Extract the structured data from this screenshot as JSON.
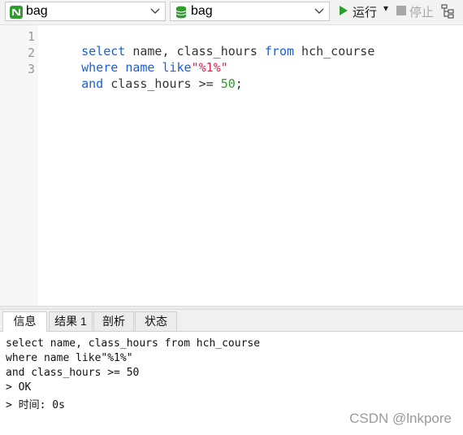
{
  "toolbar": {
    "connection": {
      "label": "bag",
      "icon": "navicat-connection-icon"
    },
    "database": {
      "label": "bag",
      "icon": "database-icon"
    },
    "run_label": "运行",
    "run_dropdown": "▾",
    "stop_label": "停止",
    "colors": {
      "run": "#2e9e2e",
      "database": "#2e9e2e",
      "connection": "#2e9e2e"
    }
  },
  "editor": {
    "line_numbers": [
      "1",
      "2",
      "3"
    ],
    "lines": [
      [
        {
          "t": "select",
          "c": "kw"
        },
        {
          "t": " name, class_hours ",
          "c": "txt"
        },
        {
          "t": "from",
          "c": "kw"
        },
        {
          "t": " hch_course",
          "c": "txt"
        }
      ],
      [
        {
          "t": "where",
          "c": "kw"
        },
        {
          "t": " ",
          "c": "txt"
        },
        {
          "t": "name",
          "c": "kw"
        },
        {
          "t": " ",
          "c": "txt"
        },
        {
          "t": "like",
          "c": "kw"
        },
        {
          "t": "\"%1%\"",
          "c": "str"
        }
      ],
      [
        {
          "t": "and",
          "c": "kw"
        },
        {
          "t": " class_hours >= ",
          "c": "txt"
        },
        {
          "t": "50",
          "c": "num"
        },
        {
          "t": ";",
          "c": "txt"
        }
      ]
    ]
  },
  "tabs": [
    {
      "label": "信息",
      "active": true
    },
    {
      "label": "结果 1",
      "active": false
    },
    {
      "label": "剖析",
      "active": false
    },
    {
      "label": "状态",
      "active": false
    }
  ],
  "output": {
    "lines": [
      "select name, class_hours from hch_course",
      "where name like\"%1%\"",
      "and class_hours >= 50",
      "> OK",
      "> 时间: 0s"
    ]
  },
  "watermark": "CSDN @lnkpore"
}
